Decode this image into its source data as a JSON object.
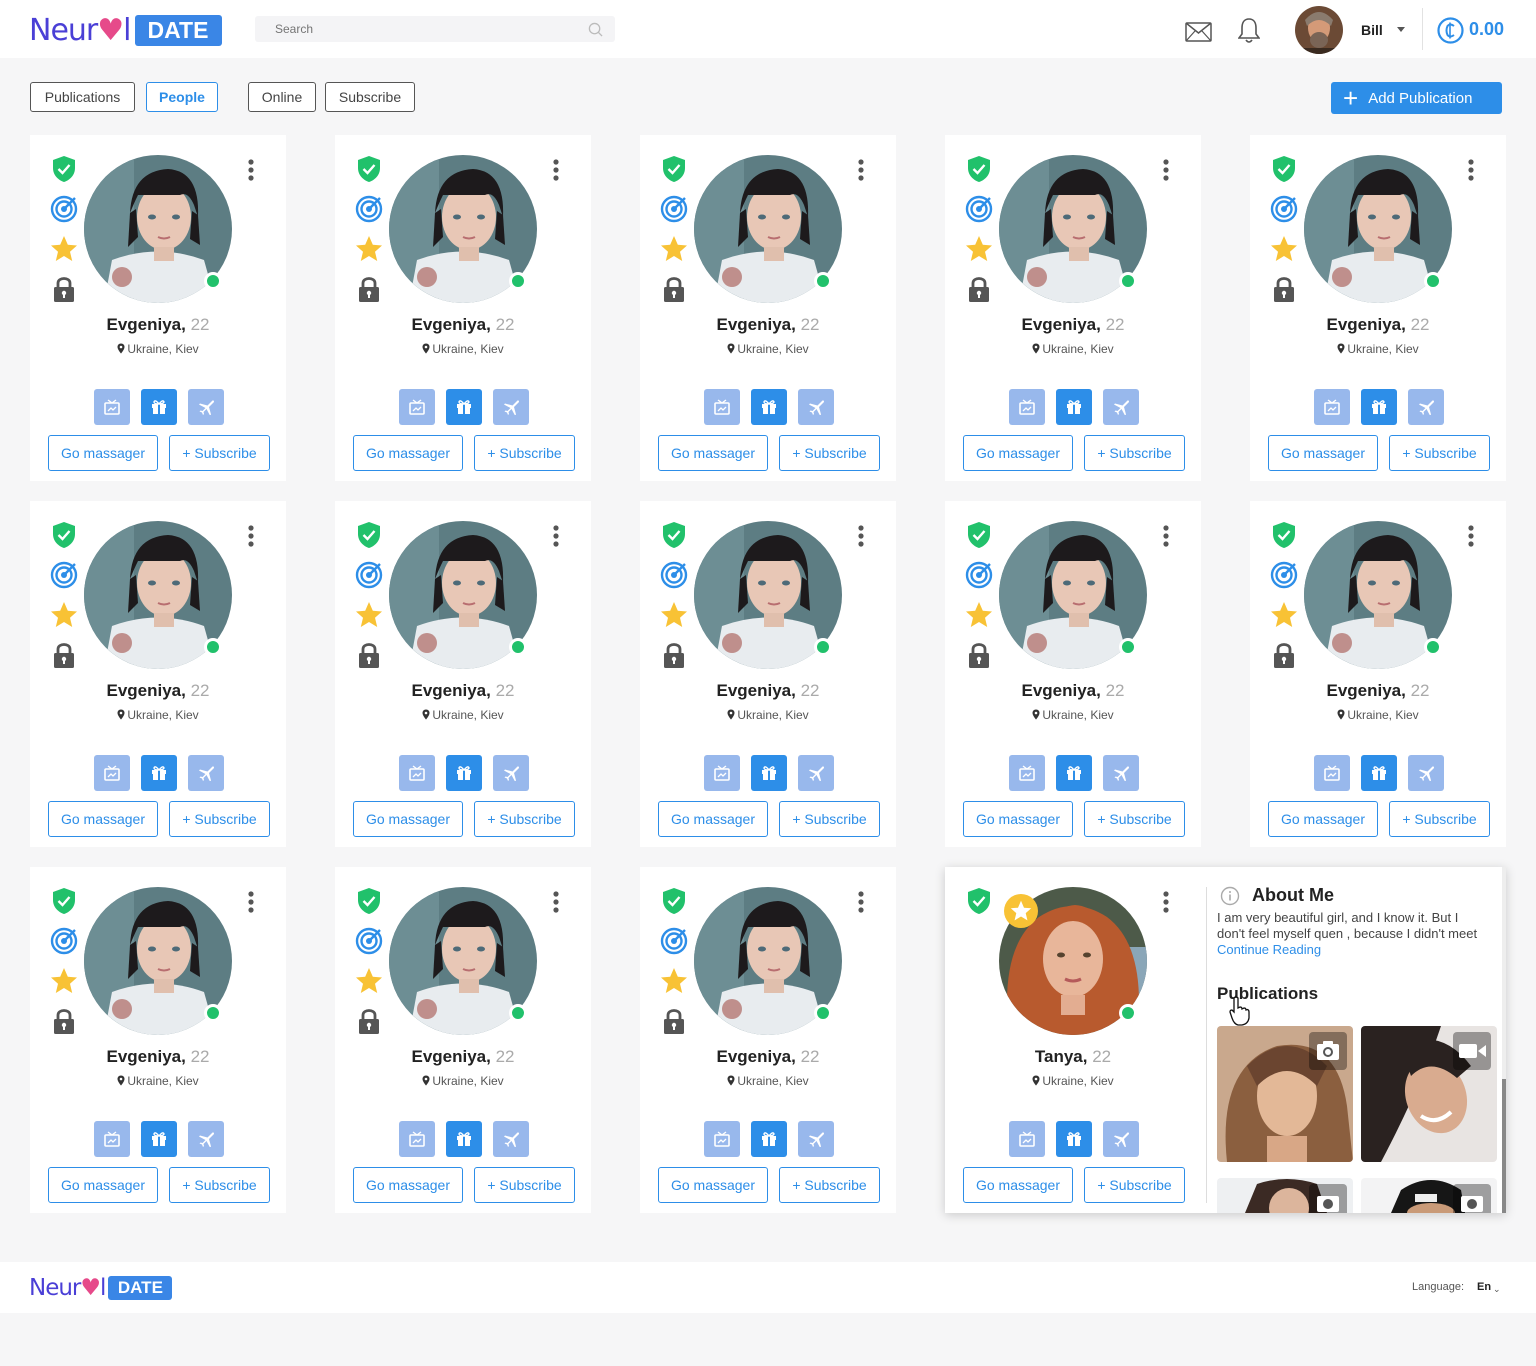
{
  "brand": {
    "neural_text": "Neur",
    "neural_suffix": "l",
    "date_text": "DATE"
  },
  "search": {
    "placeholder": "Search"
  },
  "user": {
    "name": "Bill"
  },
  "wallet": {
    "balance": "0.00"
  },
  "filters": {
    "publications": "Publications",
    "people": "People",
    "online": "Online",
    "subscribe": "Subscribe",
    "active": "People"
  },
  "add_publication": {
    "label": "Add Publication"
  },
  "card_labels": {
    "go_messenger": "Go massager",
    "subscribe": "+ Subscribe"
  },
  "people": [
    {
      "name": "Evgeniya,",
      "age": "22",
      "location": "Ukraine, Kiev"
    },
    {
      "name": "Evgeniya,",
      "age": "22",
      "location": "Ukraine, Kiev"
    },
    {
      "name": "Evgeniya,",
      "age": "22",
      "location": "Ukraine, Kiev"
    },
    {
      "name": "Evgeniya,",
      "age": "22",
      "location": "Ukraine, Kiev"
    },
    {
      "name": "Evgeniya,",
      "age": "22",
      "location": "Ukraine, Kiev"
    },
    {
      "name": "Evgeniya,",
      "age": "22",
      "location": "Ukraine, Kiev"
    },
    {
      "name": "Evgeniya,",
      "age": "22",
      "location": "Ukraine, Kiev"
    },
    {
      "name": "Evgeniya,",
      "age": "22",
      "location": "Ukraine, Kiev"
    },
    {
      "name": "Evgeniya,",
      "age": "22",
      "location": "Ukraine, Kiev"
    },
    {
      "name": "Evgeniya,",
      "age": "22",
      "location": "Ukraine, Kiev"
    },
    {
      "name": "Evgeniya,",
      "age": "22",
      "location": "Ukraine, Kiev"
    },
    {
      "name": "Evgeniya,",
      "age": "22",
      "location": "Ukraine, Kiev"
    },
    {
      "name": "Evgeniya,",
      "age": "22",
      "location": "Ukraine, Kiev"
    }
  ],
  "expanded": {
    "name": "Tanya,",
    "age": "22",
    "location": "Ukraine, Kiev",
    "about_title": "About Me",
    "about_text": "I am very beautiful girl, and I know it. But I don't feel myself quen , because I didn't meet",
    "continue_label": "Continue Reading",
    "publications_title": "Publications",
    "thumbs": [
      {
        "type": "camera-icon"
      },
      {
        "type": "video-icon"
      },
      {
        "type": "camera-icon"
      },
      {
        "type": "camera-icon"
      }
    ]
  },
  "footer": {
    "language_label": "Language:",
    "language_value": "En"
  },
  "colors": {
    "accent": "#2d8ee8",
    "online": "#21c16b",
    "verified": "#21c16b",
    "star": "#f8c235",
    "lock": "#555555"
  },
  "icons": [
    "search-icon",
    "mail-icon",
    "bell-icon",
    "coin-icon",
    "shield-check-icon",
    "target-icon",
    "star-icon",
    "lock-icon",
    "more-vert-icon",
    "location-pin-icon",
    "video-chat-icon",
    "gift-icon",
    "plane-icon",
    "info-icon",
    "camera-icon",
    "video-icon",
    "cursor-icon",
    "plus-icon"
  ]
}
